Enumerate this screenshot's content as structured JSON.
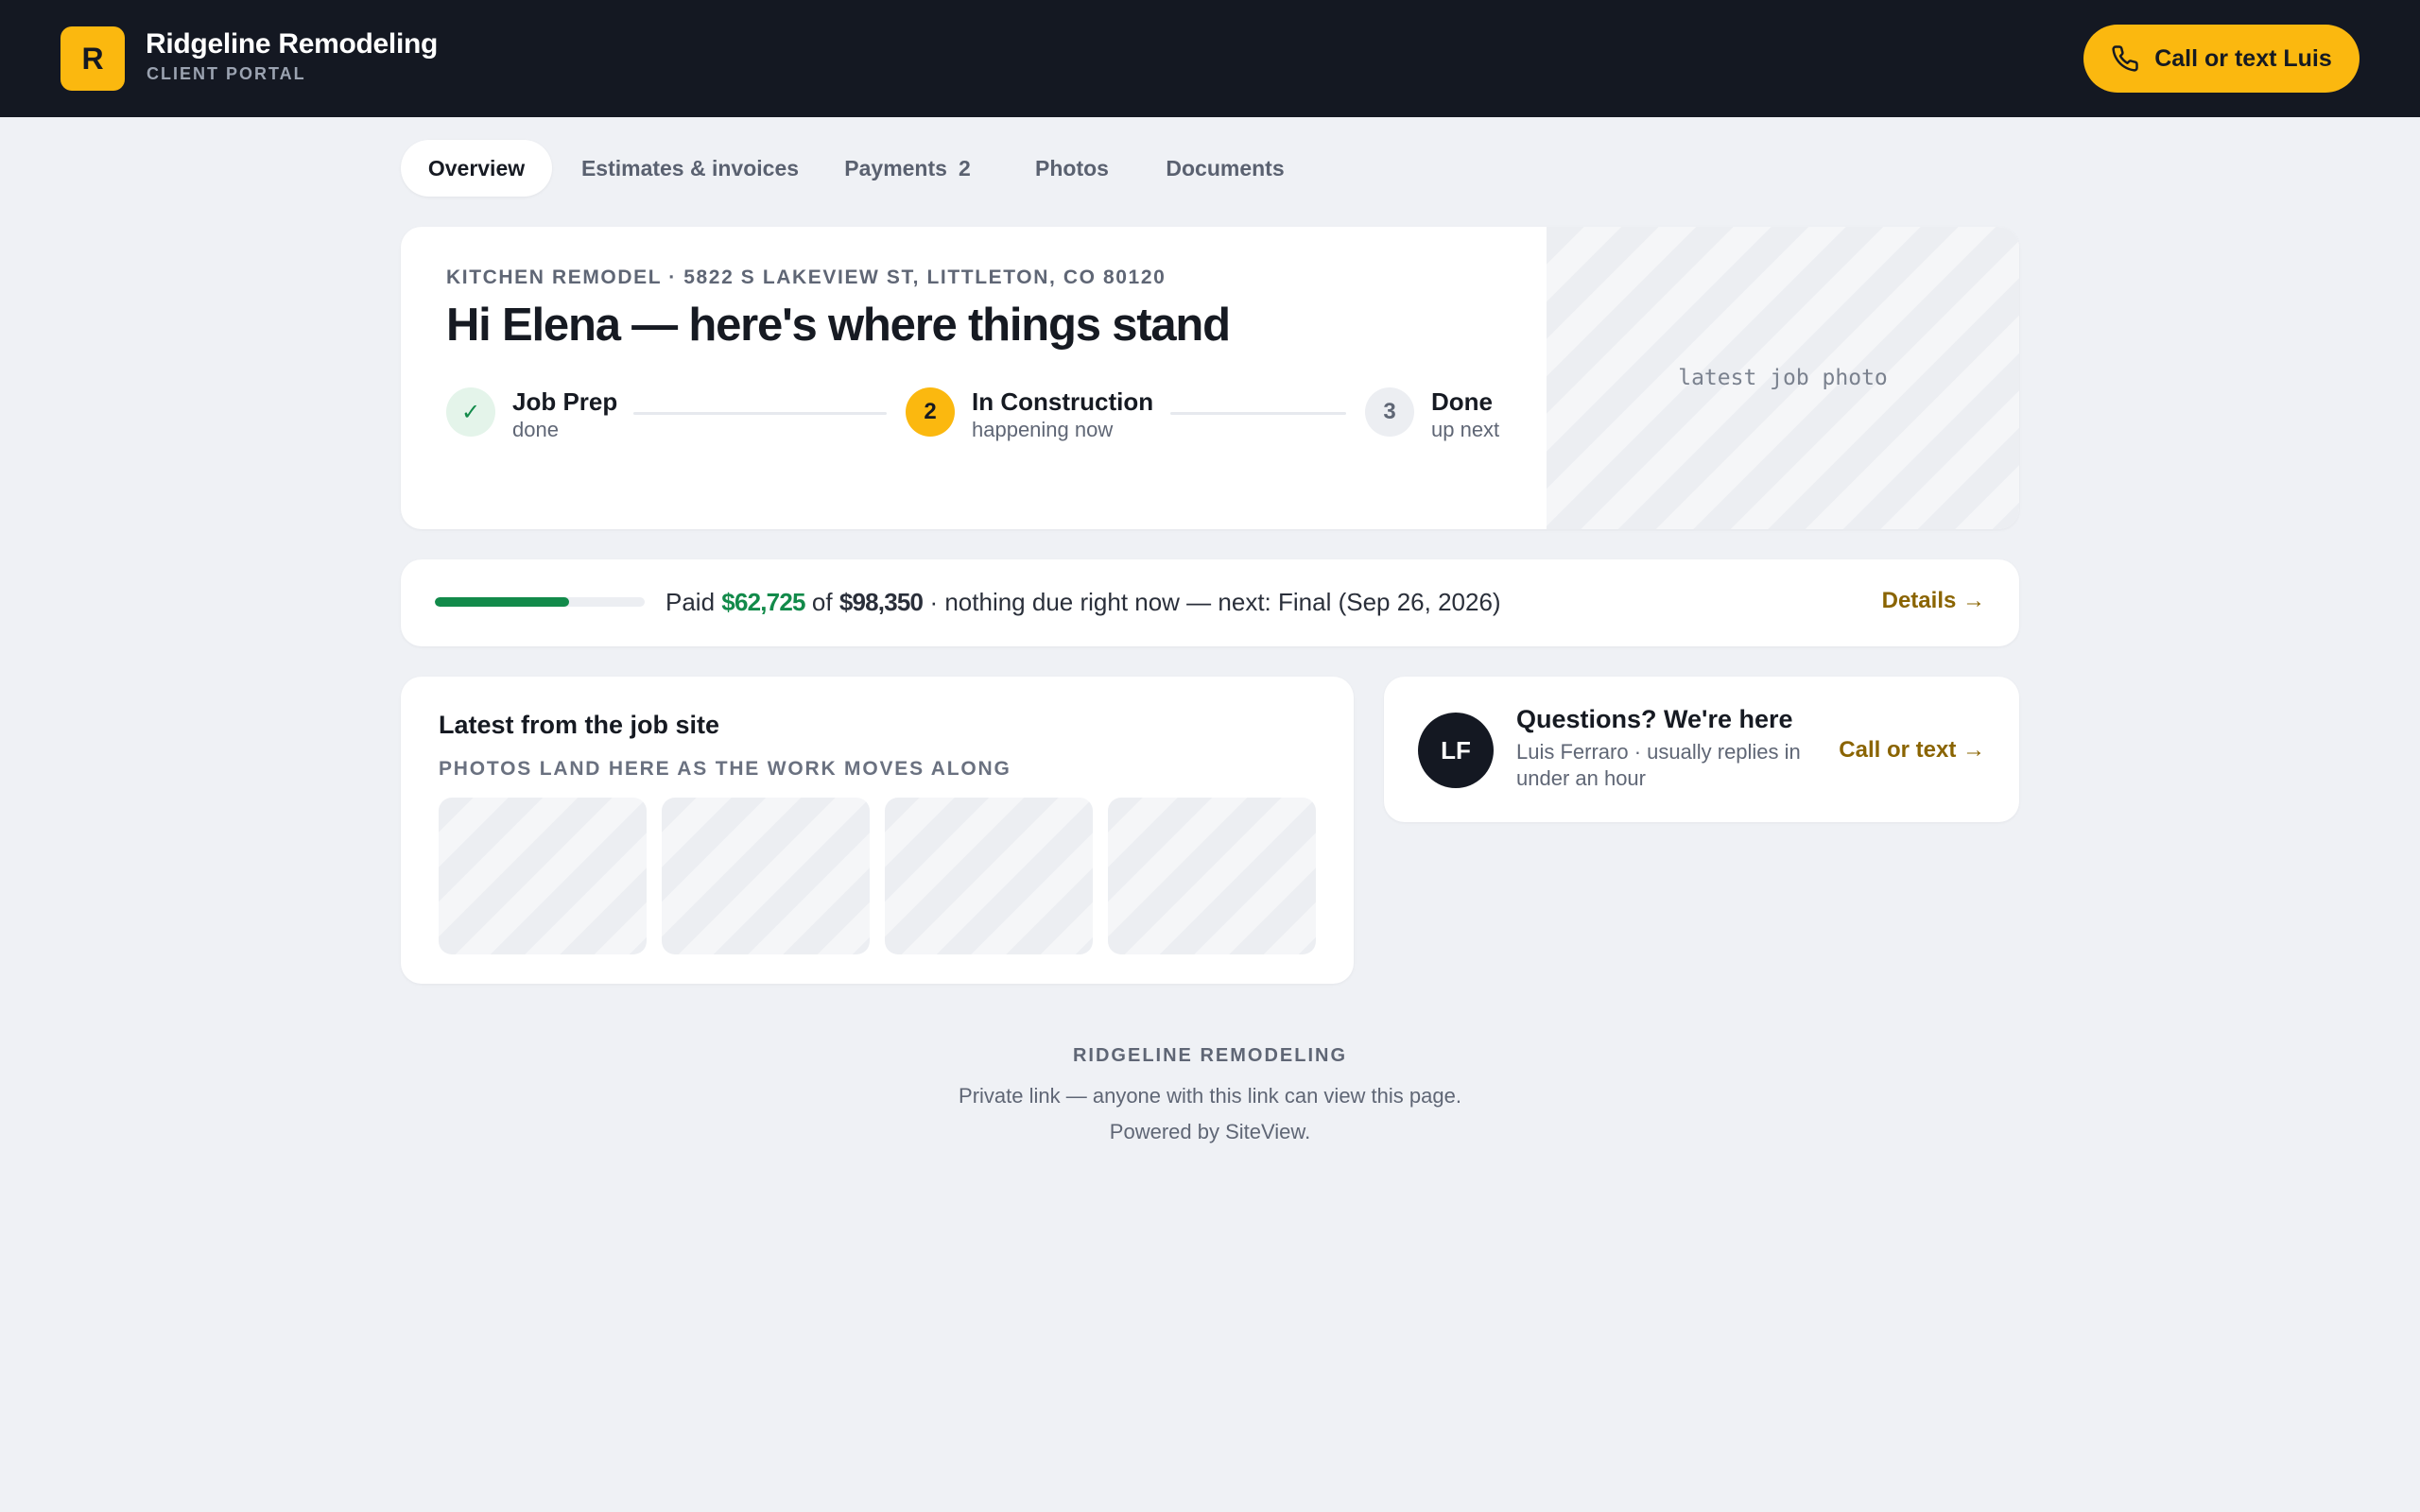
{
  "header": {
    "logo_letter": "R",
    "brand_name": "Ridgeline Remodeling",
    "brand_subtitle": "CLIENT PORTAL",
    "call_button_label": "Call or text Luis",
    "call_icon": "phone-icon",
    "accent_color": "#fbb80f"
  },
  "tabs": [
    {
      "label": "Overview",
      "active": true
    },
    {
      "label": "Estimates & invoices"
    },
    {
      "label": "Payments",
      "count": "2"
    },
    {
      "label": "Photos"
    },
    {
      "label": "Documents"
    }
  ],
  "hero": {
    "eyebrow": "KITCHEN REMODEL · 5822 S LAKEVIEW ST, LITTLETON, CO 80120",
    "title": "Hi Elena — here's where things stand",
    "photo_placeholder": "latest job photo",
    "steps": [
      {
        "marker": "✓",
        "name": "Job Prep",
        "status": "done",
        "state": "complete"
      },
      {
        "marker": "2",
        "name": "In Construction",
        "status": "happening now",
        "state": "current"
      },
      {
        "marker": "3",
        "name": "Done",
        "status": "up next",
        "state": "upcoming"
      }
    ]
  },
  "payment": {
    "paid_prefix": "Paid",
    "paid_amount": "$62,725",
    "of_word": "of",
    "total_amount": "$98,350",
    "note": "· nothing due right now — next: Final (Sep 26, 2026)",
    "progress_fraction": 0.638,
    "details_link": "Details →",
    "progress_color": "#128a4a"
  },
  "photos": {
    "title": "Latest from the job site",
    "subtitle": "PHOTOS LAND HERE AS THE WORK MOVES ALONG",
    "thumbnail_count": 4
  },
  "contact": {
    "avatar_initials": "LF",
    "title": "Questions? We're here",
    "subtitle": "Luis Ferraro · usually replies in under an hour",
    "link": "Call or text →"
  },
  "footer": {
    "brand": "RIDGELINE REMODELING",
    "privacy_note": "Private link — anyone with this link can view this page.",
    "powered_by": "Powered by SiteView."
  }
}
